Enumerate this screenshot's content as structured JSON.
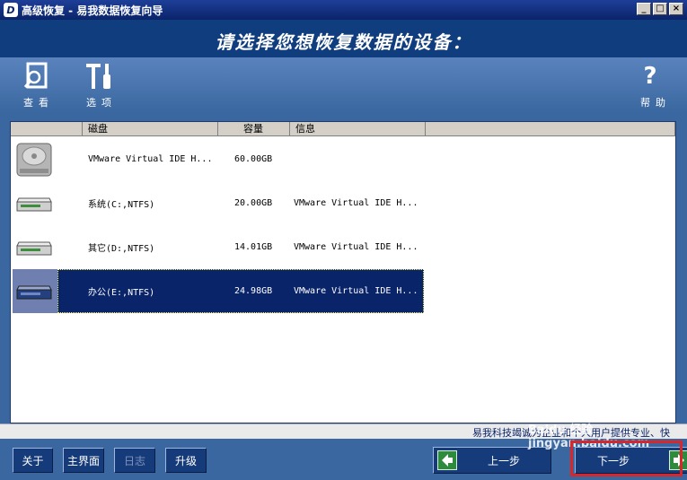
{
  "window": {
    "title": "高级恢复 - 易我数据恢复向导",
    "logo_letter": "D",
    "controls": [
      "_",
      "□",
      "×"
    ]
  },
  "header": {
    "title": "请选择您想恢复数据的设备："
  },
  "toolbar": {
    "view_label": "查看",
    "options_label": "选项",
    "help_label": "帮助",
    "help_symbol": "?"
  },
  "table": {
    "columns": [
      "",
      "磁盘",
      "容量",
      "信息",
      ""
    ],
    "rows": [
      {
        "icon": "hard-disk-icon",
        "name": "VMware Virtual IDE H...",
        "size": "60.00GB",
        "info": ""
      },
      {
        "icon": "partition-icon",
        "name": "系统(C:,NTFS)",
        "size": "20.00GB",
        "info": "VMware Virtual IDE H..."
      },
      {
        "icon": "partition-icon",
        "name": "其它(D:,NTFS)",
        "size": "14.01GB",
        "info": "VMware Virtual IDE H..."
      },
      {
        "icon": "partition-icon",
        "name": "办公(E:,NTFS)",
        "size": "24.98GB",
        "info": "VMware Virtual IDE H...",
        "selected": true
      }
    ]
  },
  "status_strip": {
    "text": "易我科技竭诚为企业和个人用户提供专业、快"
  },
  "buttons": {
    "about": "关于",
    "main": "主界面",
    "log": "日志",
    "upgrade": "升级",
    "prev": "上一步",
    "next": "下一步"
  },
  "watermark": "Baidu 经验 jingyan.baidu.com",
  "colors": {
    "title_bar": "#0a246a",
    "header": "#103d7e",
    "panel_bg": "#3a679f",
    "selected_row": "#0a246a",
    "arrow_green": "#2e8b3e",
    "highlight_box": "#d8262a"
  }
}
